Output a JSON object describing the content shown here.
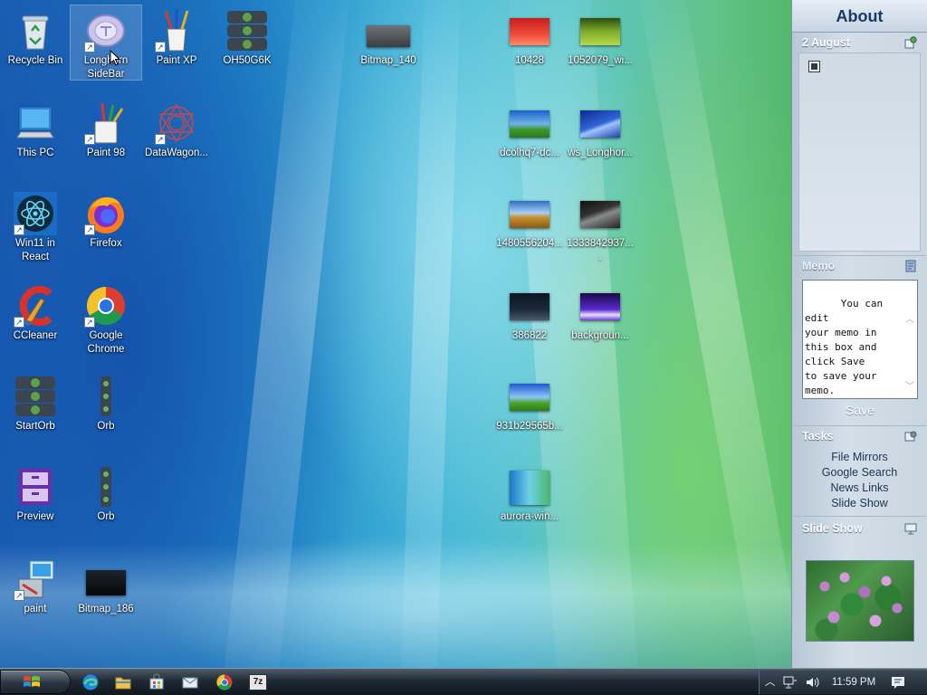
{
  "desktop": {
    "icons": [
      {
        "label": "Recycle Bin",
        "icon": "recycle-bin-icon"
      },
      {
        "label": "Longhorn SideBar",
        "icon": "sidebar-app-icon"
      },
      {
        "label": "Paint XP",
        "icon": "paint-brushes-icon"
      },
      {
        "label": "OH50G6K",
        "icon": "windows-orb-stack-icon"
      },
      {
        "label": "Bitmap_140",
        "icon": "bitmap-thumbnail-icon"
      },
      {
        "label": "10428",
        "icon": "image-thumbnail-icon"
      },
      {
        "label": "1052079_wi...",
        "icon": "image-thumbnail-icon"
      },
      {
        "label": "This PC",
        "icon": "computer-icon"
      },
      {
        "label": "Paint 98",
        "icon": "paint-bucket-icon"
      },
      {
        "label": "DataWagon...",
        "icon": "datawagon-icon"
      },
      {
        "label": "dcolhq7-dc...",
        "icon": "image-thumbnail-icon"
      },
      {
        "label": "ws_Longhor...",
        "icon": "image-thumbnail-icon"
      },
      {
        "label": "Win11 in React",
        "icon": "react-icon"
      },
      {
        "label": "Firefox",
        "icon": "firefox-icon"
      },
      {
        "label": "1480556204...",
        "icon": "image-thumbnail-icon"
      },
      {
        "label": "1333842937....",
        "icon": "image-thumbnail-icon"
      },
      {
        "label": "CCleaner",
        "icon": "ccleaner-icon"
      },
      {
        "label": "Google Chrome",
        "icon": "chrome-icon"
      },
      {
        "label": "386822",
        "icon": "image-thumbnail-icon"
      },
      {
        "label": "backgroun...",
        "icon": "image-thumbnail-icon"
      },
      {
        "label": "StartOrb",
        "icon": "windows-orb-stack-icon"
      },
      {
        "label": "Orb",
        "icon": "orb-strip-icon"
      },
      {
        "label": "931b29565b...",
        "icon": "image-thumbnail-icon"
      },
      {
        "label": "Preview",
        "icon": "preview-icon"
      },
      {
        "label": "Orb",
        "icon": "orb-strip-icon"
      },
      {
        "label": "aurora-win...",
        "icon": "image-thumbnail-icon"
      },
      {
        "label": "paint",
        "icon": "paint-installer-icon"
      },
      {
        "label": "Bitmap_186",
        "icon": "bitmap-thumbnail-icon"
      }
    ]
  },
  "sidebar": {
    "title": "About",
    "calendar": {
      "date": "2 August",
      "icon": "calendar-settings-icon"
    },
    "memo": {
      "title": "Memo",
      "text": "You can edit\nyour memo in\nthis box and\nclick Save\nto save your\nmemo.",
      "save_label": "Save",
      "icon": "memo-icon"
    },
    "tasks": {
      "title": "Tasks",
      "items": [
        "File Mirrors",
        "Google Search",
        "News Links",
        "Slide Show"
      ],
      "icon": "tasks-settings-icon"
    },
    "slideshow": {
      "title": "Slide Show",
      "icon": "slideshow-icon",
      "image": "water-lilies-photo"
    }
  },
  "taskbar": {
    "start_icon": "windows-logo-icon",
    "pinned": [
      "edge-icon",
      "file-explorer-icon",
      "store-icon",
      "mail-icon",
      "chrome-icon",
      "7zip-icon"
    ],
    "pinned_labels": {
      "sevenzip": "7z"
    },
    "tray": {
      "clock": "11:59 PM"
    }
  }
}
